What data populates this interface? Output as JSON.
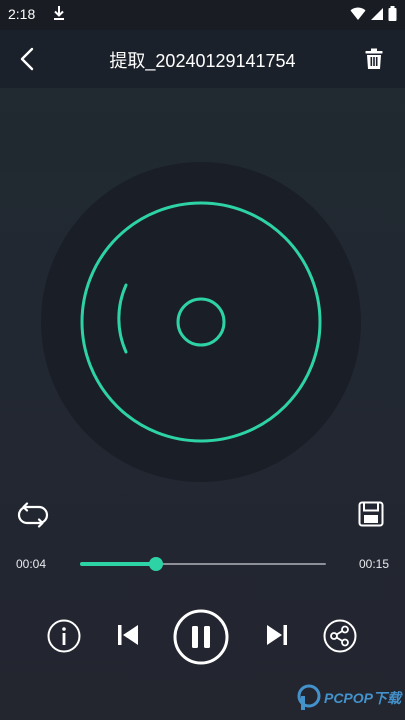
{
  "status_bar": {
    "time": "2:18",
    "icons": [
      "download-icon",
      "wifi-icon",
      "signal-icon",
      "battery-icon"
    ]
  },
  "header": {
    "title": "提取_20240129141754",
    "back_icon": "chevron-left-icon",
    "delete_icon": "trash-icon"
  },
  "player": {
    "current_time": "00:04",
    "total_time": "00:15",
    "progress": 0.31,
    "state": "playing",
    "controls": [
      "loop-icon",
      "save-icon",
      "info-icon",
      "previous-icon",
      "pause-icon",
      "next-icon",
      "share-icon"
    ]
  },
  "colors": {
    "accent": "#2ed3a5",
    "background": "#222832",
    "appbar": "#1b212a",
    "disc": "#1a1e26",
    "watermark": "#49a6e8"
  },
  "watermark": {
    "text": "PCPOP下载"
  }
}
